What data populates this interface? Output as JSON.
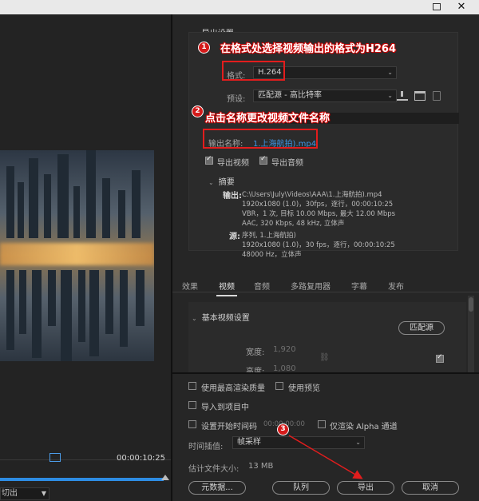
{
  "window": {
    "close_glyph": "✕"
  },
  "source": {
    "timecode": "00:00:10:25",
    "view_select": "切出"
  },
  "export_settings": {
    "header": "导出设置",
    "format_label": "格式:",
    "format_value": "H.264",
    "preset_label": "预设:",
    "preset_value": "匹配源 - 高比特率",
    "output_name_label": "输出名称:",
    "output_name_value": "1.上海航拍).mp4",
    "export_video_label": "导出视频",
    "export_audio_label": "导出音频",
    "summary_header": "摘要",
    "output_key": "输出:",
    "output_lines": [
      "C:\\Users\\July\\Videos\\AAA\\1.上海航拍).mp4",
      "1920x1080 (1.0)，30fps，逐行，00:00:10:25",
      "VBR，1 次, 目标 10.00 Mbps, 最大 12.00 Mbps",
      "AAC, 320 Kbps, 48 kHz, 立体声"
    ],
    "source_key": "源:",
    "source_lines": [
      "序列, 1.上海航拍)",
      "1920x1080 (1.0)，30 fps，逐行，00:00:10:25",
      "48000 Hz，立体声"
    ]
  },
  "tabs": [
    "效果",
    "视频",
    "音频",
    "多路复用器",
    "字幕",
    "发布"
  ],
  "video_settings": {
    "header": "基本视频设置",
    "match_source_button": "匹配源",
    "width_label": "宽度:",
    "width_value": "1,920",
    "height_label": "高度:",
    "height_value": "1,080"
  },
  "bottom": {
    "max_render_quality": "使用最高渲染质量",
    "use_previews": "使用预览",
    "import_into_project": "导入到项目中",
    "set_start_timecode": "设置开始时间码",
    "start_timecode_value": "00:00:00:00",
    "render_alpha_only": "仅渲染 Alpha 通道",
    "time_interpolation_label": "时间插值:",
    "time_interpolation_value": "帧采样",
    "estimated_size_label": "估计文件大小:",
    "estimated_size_value": "13 MB",
    "metadata_button": "元数据...",
    "queue_button": "队列",
    "export_button": "导出",
    "cancel_button": "取消"
  },
  "annotations": {
    "step1_number": "1",
    "step1_text": "在格式处选择视频输出的格式为H264",
    "step2_number": "2",
    "step2_text": "点击名称更改视频文件名称",
    "step3_number": "3",
    "annotation_color": "#e21d1d"
  },
  "colors": {
    "accent_blue": "#2d8ce3",
    "link_blue": "#3d95e4"
  }
}
